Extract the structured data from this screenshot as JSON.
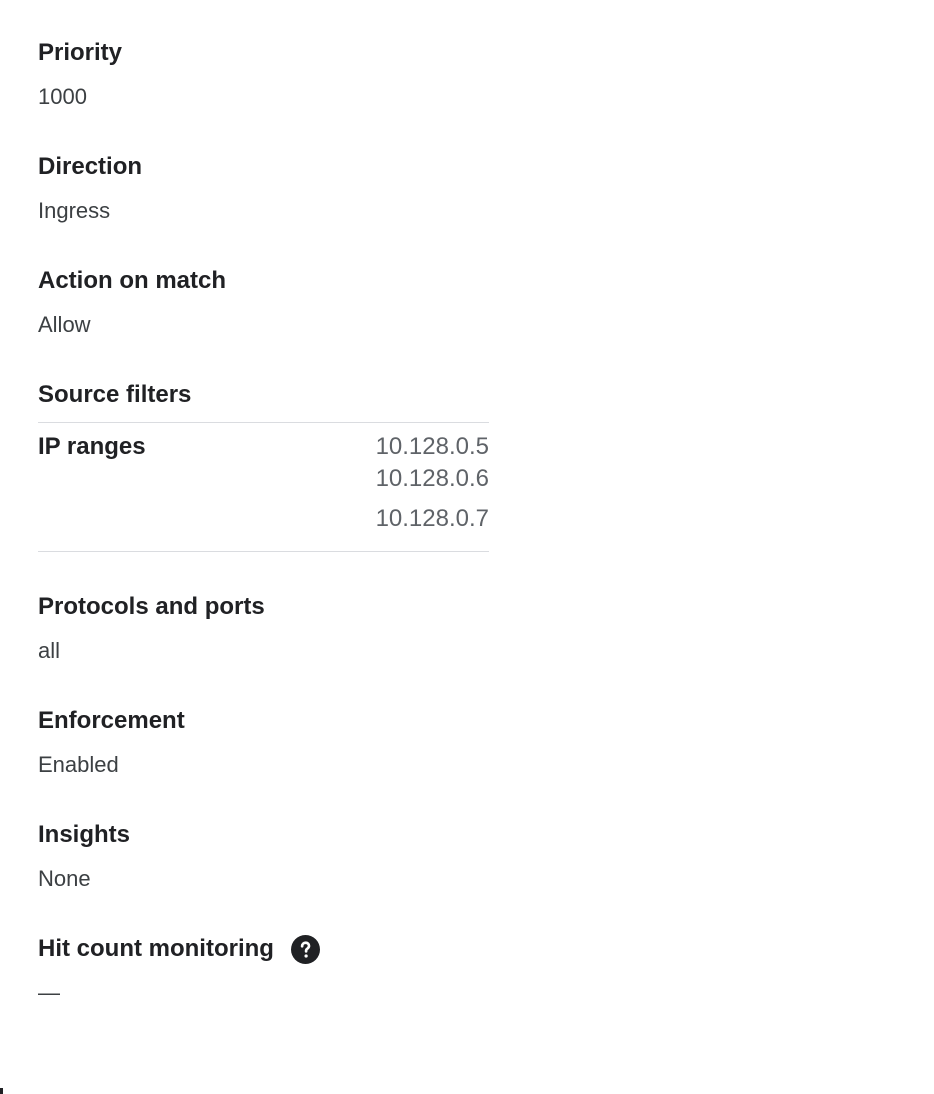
{
  "fields": {
    "priority": {
      "label": "Priority",
      "value": "1000"
    },
    "direction": {
      "label": "Direction",
      "value": "Ingress"
    },
    "action": {
      "label": "Action on match",
      "value": "Allow"
    },
    "protocols": {
      "label": "Protocols and ports",
      "value": "all"
    },
    "enforcement": {
      "label": "Enforcement",
      "value": "Enabled"
    },
    "insights": {
      "label": "Insights",
      "value": "None"
    },
    "hit_count": {
      "label": "Hit count monitoring",
      "value": "—",
      "help_icon": "help-circle-icon"
    }
  },
  "source_filters": {
    "title": "Source filters",
    "key": "IP ranges",
    "values": [
      "10.128.0.5",
      "10.128.0.6",
      "10.128.0.7"
    ]
  }
}
